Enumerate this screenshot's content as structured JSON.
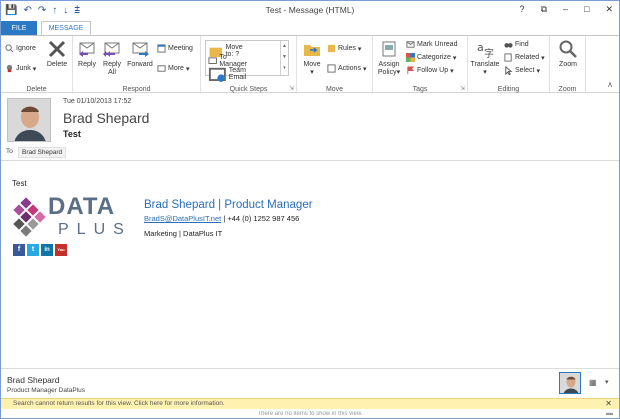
{
  "window": {
    "title": "Test - Message (HTML)",
    "controls": [
      "?",
      "⧉",
      "–",
      "□",
      "✕"
    ]
  },
  "qat": [
    "💾",
    "↶",
    "↷",
    "↑",
    "↓",
    "⩲"
  ],
  "tabs": {
    "file": "FILE",
    "message": "MESSAGE"
  },
  "ribbon": {
    "delete_group": {
      "label": "Delete",
      "ignore": "Ignore",
      "junk": "Junk",
      "delete": "Delete"
    },
    "respond_group": {
      "label": "Respond",
      "reply": "Reply",
      "reply_all_1": "Reply",
      "reply_all_2": "All",
      "forward": "Forward",
      "meeting": "Meeting",
      "more": "More"
    },
    "quicksteps_group": {
      "label": "Quick Steps",
      "items": [
        "Move to: ?",
        "To Manager",
        "Team Email"
      ]
    },
    "move_group": {
      "label": "Move",
      "move": "Move",
      "rules": "Rules",
      "actions": "Actions"
    },
    "tags_group": {
      "label": "Tags",
      "assign_1": "Assign",
      "assign_2": "Policy",
      "mark_unread": "Mark Unread",
      "categorize": "Categorize",
      "follow_up": "Follow Up"
    },
    "editing_group": {
      "label": "Editing",
      "translate": "Translate",
      "find": "Find",
      "related": "Related",
      "select": "Select"
    },
    "zoom_group": {
      "label": "Zoom",
      "zoom": "Zoom"
    }
  },
  "message": {
    "date": "Tue 01/10/2013 17:52",
    "sender": "Brad Shepard",
    "subject": "Test",
    "to_label": "To",
    "to": "Brad Shepard",
    "body": "Test"
  },
  "signature": {
    "logo_top": "DATA",
    "logo_bottom": "PLUS",
    "name_line": "Brad Shepard | Product Manager",
    "email": "BradS@DataPlusIT.net",
    "phone": "| +44 (0) 1252 987 456",
    "company_line": "Marketing | DataPlus IT",
    "socials": [
      {
        "name": "facebook",
        "glyph": "f",
        "color": "#3b5998"
      },
      {
        "name": "twitter",
        "glyph": "t",
        "color": "#29a9e1"
      },
      {
        "name": "linkedin",
        "glyph": "in",
        "color": "#0e76a8"
      },
      {
        "name": "youtube",
        "glyph": "You",
        "color": "#c4302b"
      }
    ]
  },
  "people_pane": {
    "name": "Brad Shepard",
    "title": "Product Manager DataPlus"
  },
  "infobar": {
    "text": "Search cannot return results for this view. Click here for more information.",
    "close": "✕"
  },
  "status": {
    "text": "There are no items to show in this view."
  },
  "colors": {
    "accent": "#2b78c5",
    "brand_blue": "#2a6ebb",
    "infobar_bg": "#fff1b0"
  }
}
